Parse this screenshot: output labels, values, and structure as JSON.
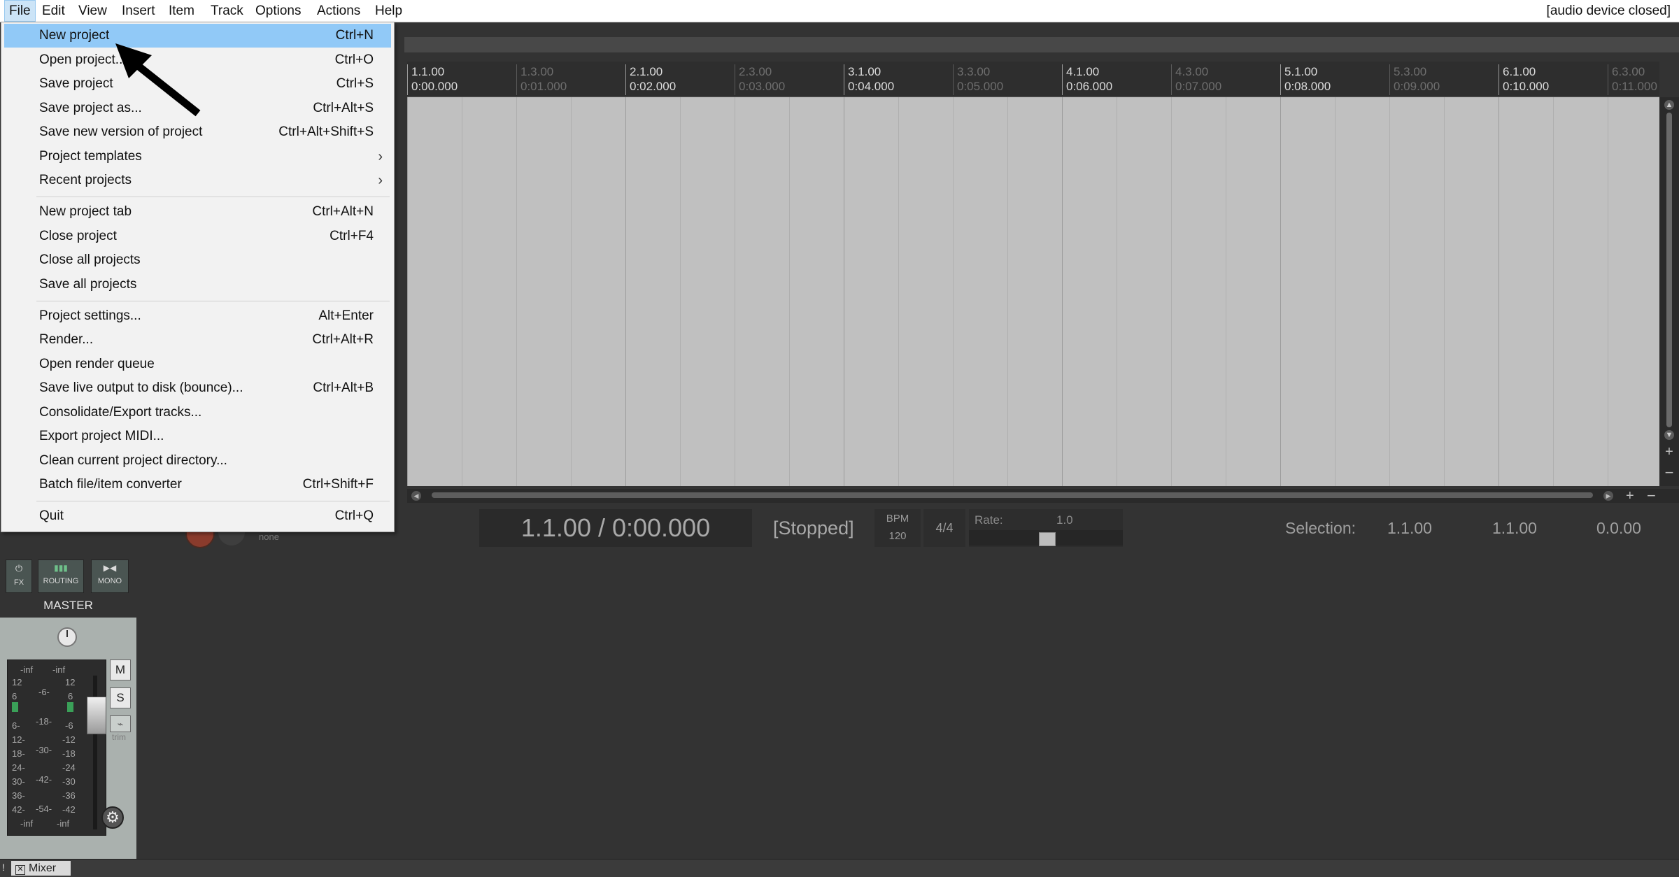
{
  "menubar": {
    "items": [
      {
        "label": "File"
      },
      {
        "label": "Edit"
      },
      {
        "label": "View"
      },
      {
        "label": "Insert"
      },
      {
        "label": "Item"
      },
      {
        "label": "Track"
      },
      {
        "label": "Options"
      },
      {
        "label": "Actions"
      },
      {
        "label": "Help"
      }
    ],
    "status": "[audio device closed]"
  },
  "file_menu": {
    "items": [
      {
        "label": "New project",
        "shortcut": "Ctrl+N",
        "highlighted": true
      },
      {
        "label": "Open project...",
        "shortcut": "Ctrl+O"
      },
      {
        "label": "Save project",
        "shortcut": "Ctrl+S"
      },
      {
        "label": "Save project as...",
        "shortcut": "Ctrl+Alt+S"
      },
      {
        "label": "Save new version of project",
        "shortcut": "Ctrl+Alt+Shift+S"
      },
      {
        "label": "Project templates",
        "submenu": true
      },
      {
        "label": "Recent projects",
        "submenu": true
      },
      {
        "label": "New project tab",
        "shortcut": "Ctrl+Alt+N"
      },
      {
        "label": "Close project",
        "shortcut": "Ctrl+F4"
      },
      {
        "label": "Close all projects",
        "shortcut": ""
      },
      {
        "label": "Save all projects",
        "shortcut": ""
      },
      {
        "label": "Project settings...",
        "shortcut": "Alt+Enter"
      },
      {
        "label": "Render...",
        "shortcut": "Ctrl+Alt+R"
      },
      {
        "label": "Open render queue",
        "shortcut": ""
      },
      {
        "label": "Save live output to disk (bounce)...",
        "shortcut": "Ctrl+Alt+B"
      },
      {
        "label": "Consolidate/Export tracks...",
        "shortcut": ""
      },
      {
        "label": "Export project MIDI...",
        "shortcut": ""
      },
      {
        "label": "Clean current project directory...",
        "shortcut": ""
      },
      {
        "label": "Batch file/item converter",
        "shortcut": "Ctrl+Shift+F"
      },
      {
        "label": "Quit",
        "shortcut": "Ctrl+Q"
      }
    ]
  },
  "ruler": {
    "marks": [
      {
        "bar": "1.1.00",
        "time": "0:00.000",
        "major": true
      },
      {
        "bar": "1.3.00",
        "time": "0:01.000",
        "major": false
      },
      {
        "bar": "2.1.00",
        "time": "0:02.000",
        "major": true
      },
      {
        "bar": "2.3.00",
        "time": "0:03.000",
        "major": false
      },
      {
        "bar": "3.1.00",
        "time": "0:04.000",
        "major": true
      },
      {
        "bar": "3.3.00",
        "time": "0:05.000",
        "major": false
      },
      {
        "bar": "4.1.00",
        "time": "0:06.000",
        "major": true
      },
      {
        "bar": "4.3.00",
        "time": "0:07.000",
        "major": false
      },
      {
        "bar": "5.1.00",
        "time": "0:08.000",
        "major": true
      },
      {
        "bar": "5.3.00",
        "time": "0:09.000",
        "major": false
      },
      {
        "bar": "6.1.00",
        "time": "0:10.000",
        "major": true
      },
      {
        "bar": "6.3.00",
        "time": "0:11.000",
        "major": false
      }
    ]
  },
  "transport": {
    "time": "1.1.00 / 0:00.000",
    "state": "[Stopped]",
    "bpm_label": "BPM",
    "bpm_value": "120",
    "time_signature": "4/4",
    "rate_label": "Rate:",
    "rate_value": "1.0",
    "selection_label": "Selection:",
    "selection_start": "1.1.00",
    "selection_end": "1.1.00",
    "selection_length": "0.0.00",
    "record_mode": "none"
  },
  "master": {
    "fx_label": "FX",
    "routing_label": "ROUTING",
    "mono_label": "MONO",
    "label": "MASTER",
    "mute_label": "M",
    "solo_label": "S",
    "trim_label": "trim",
    "meter_left": [
      "-inf",
      "12",
      "6",
      "",
      "6-",
      "12-",
      "18-",
      "24-",
      "30-",
      "36-",
      "42-",
      "-inf"
    ],
    "meter_mid": [
      "-6-",
      "-18-",
      "-30-",
      "-42-",
      "-54-"
    ],
    "meter_right": [
      "-inf",
      "12",
      "6",
      "",
      "-6",
      "-12",
      "-18",
      "-24",
      "-30",
      "-36",
      "-42",
      "-inf"
    ]
  },
  "bottom": {
    "mixer_tab": "Mixer",
    "left_marker": "!"
  },
  "colors": {
    "menu_highlight": "#91c9f7",
    "arrange_bg": "#c0c0c0",
    "app_bg": "#333333",
    "meter_green": "#3aa058"
  }
}
